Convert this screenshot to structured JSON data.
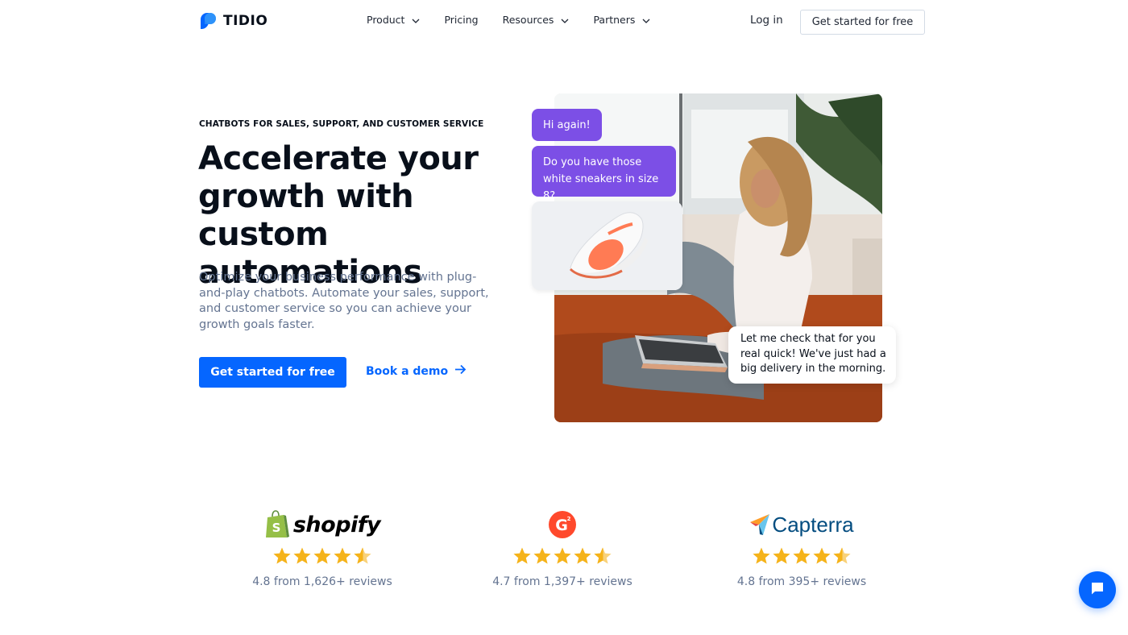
{
  "brand": {
    "name": "TIDIO",
    "colors": {
      "primary": "#0566ff",
      "purple": "#7c4fe6",
      "dark": "#080f1a",
      "muted": "#647491"
    }
  },
  "nav": {
    "items": [
      {
        "label": "Product",
        "has_dropdown": true
      },
      {
        "label": "Pricing",
        "has_dropdown": false
      },
      {
        "label": "Resources",
        "has_dropdown": true
      },
      {
        "label": "Partners",
        "has_dropdown": true
      }
    ],
    "login": "Log in",
    "cta": "Get started for free"
  },
  "hero": {
    "eyebrow": "CHATBOTS FOR SALES, SUPPORT, AND CUSTOMER SERVICE",
    "title": "Accelerate your growth with custom automations",
    "subtitle": "Optimize your business performance with plug-and-play chatbots. Automate your sales, support, and customer service so you can achieve your growth goals faster.",
    "primary_cta": "Get started for free",
    "secondary_cta": "Book a demo"
  },
  "chat": {
    "bubble_1": "Hi again!",
    "bubble_2": "Do you have those white sneakers in size 8?",
    "reply": "Let me check that for you real quick! We've just had a big delivery in the morning."
  },
  "reviews": [
    {
      "platform": "shopify",
      "logo_text": "shopify",
      "rating": 4.8,
      "stars": 4.5,
      "text": "4.8 from 1,626+ reviews"
    },
    {
      "platform": "g2",
      "logo_text": "G",
      "rating": 4.7,
      "stars": 4.5,
      "text": "4.7 from 1,397+ reviews"
    },
    {
      "platform": "capterra",
      "logo_text": "Capterra",
      "rating": 4.8,
      "stars": 4.5,
      "text": "4.8 from 395+ reviews"
    }
  ],
  "icons": {
    "logo": "tidio-logo-icon",
    "dropdown": "chevron-down-icon",
    "demo_arrow": "arrow-right-icon",
    "star": "star-icon",
    "chat": "chat-bubble-icon"
  }
}
